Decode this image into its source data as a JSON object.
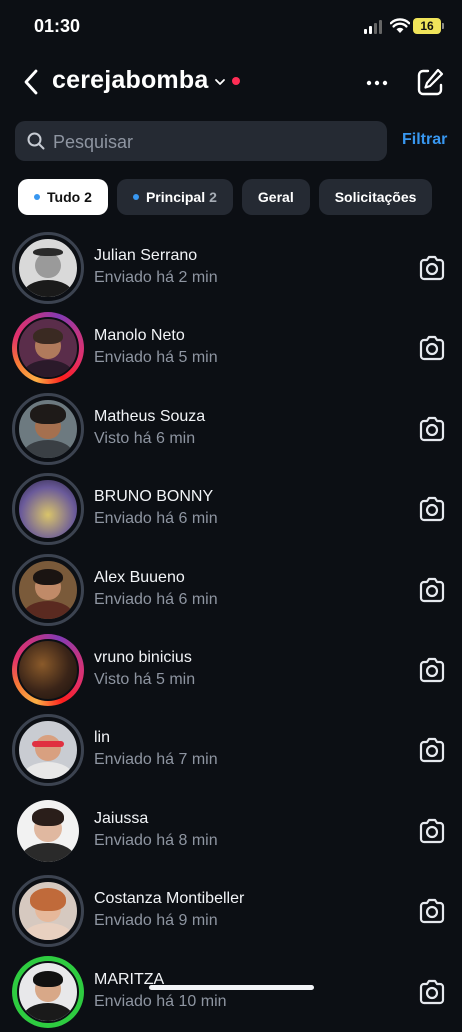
{
  "status": {
    "time": "01:30",
    "battery": "16"
  },
  "header": {
    "title": "cerejabomba",
    "back_icon": "chevron-left-icon",
    "more_icon": "ellipsis-icon",
    "compose_icon": "compose-icon"
  },
  "search": {
    "placeholder": "Pesquisar",
    "filter_label": "Filtrar"
  },
  "chips": [
    {
      "label": "Tudo",
      "count": "2",
      "dot": true,
      "active": true
    },
    {
      "label": "Principal",
      "count": "2",
      "dot": true,
      "active": false
    },
    {
      "label": "Geral",
      "count": "",
      "dot": false,
      "active": false
    },
    {
      "label": "Solicitações",
      "count": "",
      "dot": false,
      "active": false
    }
  ],
  "conversations": [
    {
      "name": "Julian Serrano",
      "status": "Enviado há 2 min"
    },
    {
      "name": "Manolo Neto",
      "status": "Enviado há 5 min"
    },
    {
      "name": "Matheus Souza",
      "status": "Visto há 6 min"
    },
    {
      "name": "BRUNO BONNY",
      "status": "Enviado há 6 min"
    },
    {
      "name": "Alex Buueno",
      "status": "Enviado há 6 min"
    },
    {
      "name": "vruno binicius",
      "status": "Visto há 5 min"
    },
    {
      "name": "lin",
      "status": "Enviado há 7 min"
    },
    {
      "name": "Jaiussa",
      "status": "Enviado há 8 min"
    },
    {
      "name": "Costanza Montibeller",
      "status": "Enviado há 9 min"
    },
    {
      "name": "MARITZA",
      "status": "Enviado há 10 min"
    }
  ],
  "colors": {
    "background": "#0c0f14",
    "accent": "#3897f0",
    "unread_dot": "#ff2d55",
    "secondary_text": "#8e95a1"
  }
}
